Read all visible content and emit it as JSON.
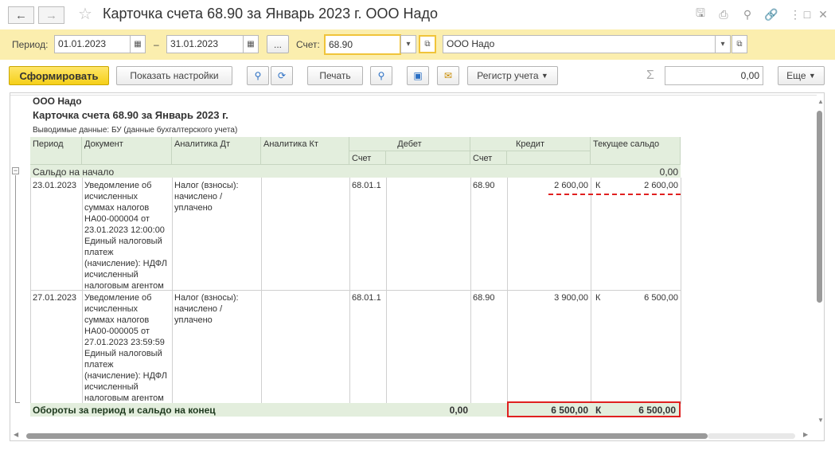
{
  "window": {
    "title": "Карточка счета 68.90 за Январь 2023 г. ООО Надо"
  },
  "filters": {
    "period_label": "Период:",
    "date_from": "01.01.2023",
    "dash": "–",
    "date_to": "31.01.2023",
    "more": "...",
    "account_label": "Счет:",
    "account": "68.90",
    "organization": "ООО Надо"
  },
  "toolbar": {
    "generate": "Сформировать",
    "show_settings": "Показать настройки",
    "print": "Печать",
    "register": "Регистр учета",
    "sum_symbol": "Σ",
    "sum_value": "0,00",
    "more": "Еще"
  },
  "report": {
    "org": "ООО Надо",
    "title": "Карточка счета 68.90 за Январь 2023 г.",
    "subtitle": "Выводимые данные: БУ (данные бухгалтерского учета)",
    "columns": {
      "period": "Период",
      "document": "Документ",
      "analytics_dt": "Аналитика Дт",
      "analytics_kt": "Аналитика Кт",
      "debit": "Дебет",
      "credit": "Кредит",
      "balance": "Текущее сальдо",
      "account": "Счет"
    },
    "opening": {
      "label": "Сальдо на начало",
      "value": "0,00"
    },
    "rows": [
      {
        "period": "23.01.2023",
        "document": "Уведомление об\nисчисленных\nсуммах налогов\nНА00-000004 от\n23.01.2023 12:00:00\nЕдиный налоговый\nплатеж\n(начисление): НДФЛ\nисчисленный\nналоговым агентом",
        "analytics_dt": "Налог (взносы):\nначислено /\nуплачено",
        "debit_account": "68.01.1",
        "credit_account": "68.90",
        "credit_amount": "2 600,00",
        "balance_side": "К",
        "balance": "2 600,00"
      },
      {
        "period": "27.01.2023",
        "document": "Уведомление об\nисчисленных\nсуммах налогов\nНА00-000005 от\n27.01.2023 23:59:59\nЕдиный налоговый\nплатеж\n(начисление): НДФЛ\nисчисленный\nналоговым агентом",
        "analytics_dt": "Налог (взносы):\nначислено /\nуплачено",
        "debit_account": "68.01.1",
        "credit_account": "68.90",
        "credit_amount": "3 900,00",
        "balance_side": "К",
        "balance": "6 500,00"
      }
    ],
    "totals": {
      "label": "Обороты за период и сальдо на конец",
      "debit": "0,00",
      "credit": "6 500,00",
      "side": "К",
      "balance": "6 500,00"
    }
  },
  "colors": {
    "highlight": "#e02020",
    "header_bg": "#e3eedd",
    "filter_bg": "#fbeeae",
    "primary": "#f5cf19"
  },
  "icons": [
    "back-arrow-icon",
    "forward-arrow-icon",
    "star-icon",
    "save-icon",
    "print-icon",
    "preview-icon",
    "link-icon",
    "kebab-menu-icon",
    "maximize-icon",
    "close-icon",
    "calendar-icon",
    "dropdown-icon",
    "open-icon",
    "search-icon",
    "refresh-search-icon",
    "print-preview-icon",
    "save-disk-icon",
    "envelope-icon",
    "collapse-icon"
  ]
}
